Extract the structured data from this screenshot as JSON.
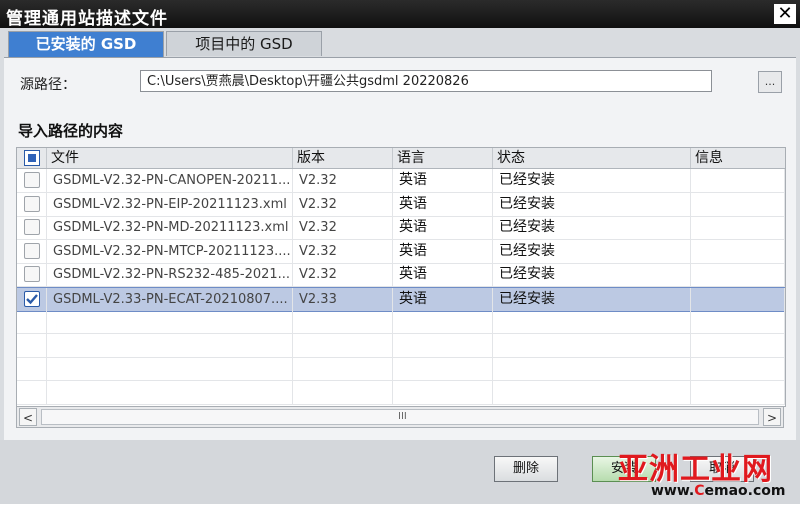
{
  "window": {
    "title": "管理通用站描述文件",
    "close_label": "✕"
  },
  "tabs": [
    {
      "label": "已安装的 GSD",
      "active": true
    },
    {
      "label": "项目中的 GSD",
      "active": false
    }
  ],
  "source": {
    "label": "源路径：",
    "value": "C:\\Users\\贾燕晨\\Desktop\\开疆公共gsdml 20220826",
    "browse_label": "..."
  },
  "section_title": "导入路径的内容",
  "table": {
    "columns": [
      "文件",
      "版本",
      "语言",
      "状态",
      "信息"
    ],
    "rows": [
      {
        "file": "GSDML-V2.32-PN-CANOPEN-20211...",
        "version": "V2.32",
        "language": "英语",
        "status": "已经安装",
        "info": "",
        "checked": false
      },
      {
        "file": "GSDML-V2.32-PN-EIP-20211123.xml",
        "version": "V2.32",
        "language": "英语",
        "status": "已经安装",
        "info": "",
        "checked": false
      },
      {
        "file": "GSDML-V2.32-PN-MD-20211123.xml",
        "version": "V2.32",
        "language": "英语",
        "status": "已经安装",
        "info": "",
        "checked": false
      },
      {
        "file": "GSDML-V2.32-PN-MTCP-20211123....",
        "version": "V2.32",
        "language": "英语",
        "status": "已经安装",
        "info": "",
        "checked": false
      },
      {
        "file": "GSDML-V2.32-PN-RS232-485-2021...",
        "version": "V2.32",
        "language": "英语",
        "status": "已经安装",
        "info": "",
        "checked": false
      },
      {
        "file": "GSDML-V2.33-PN-ECAT-20210807....",
        "version": "V2.33",
        "language": "英语",
        "status": "已经安装",
        "info": "",
        "checked": true
      }
    ]
  },
  "scrollbar": {
    "left": "<",
    "right": ">",
    "grip": "III"
  },
  "buttons": {
    "delete": "删除",
    "install": "安装",
    "cancel": "取消"
  },
  "watermark": {
    "main": "亚洲工业网",
    "prefix": "www.",
    "c": "C",
    "rest": "emao.com"
  },
  "colors": {
    "tab_active": "#3f7fd1",
    "selected_row": "#bcc9e3",
    "watermark": "#e0191e"
  }
}
